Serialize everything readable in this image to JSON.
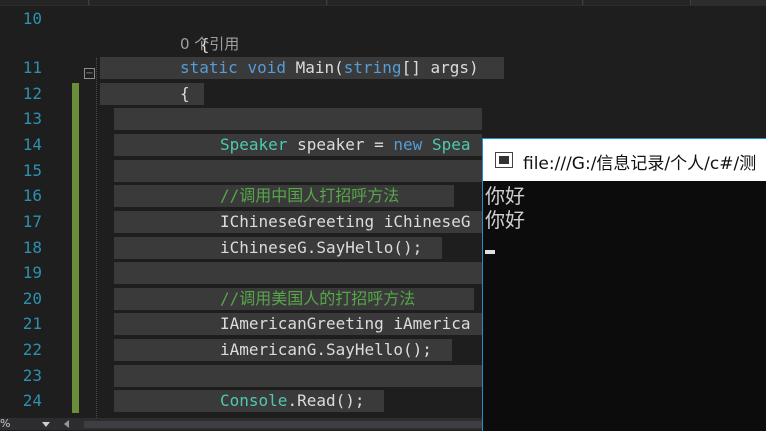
{
  "editor": {
    "ref_count": "0 个引用",
    "lines": [
      {
        "num": "10",
        "code": [
          {
            "t": "{",
            "c": ""
          }
        ]
      },
      {
        "num": "11",
        "code": [
          {
            "t": "static",
            "c": "kw"
          },
          {
            "t": " ",
            "c": ""
          },
          {
            "t": "void",
            "c": "kw"
          },
          {
            "t": " Main(",
            "c": ""
          },
          {
            "t": "string",
            "c": "kw"
          },
          {
            "t": "[] args)",
            "c": ""
          }
        ]
      },
      {
        "num": "12",
        "code": [
          {
            "t": "{",
            "c": ""
          }
        ]
      },
      {
        "num": "13",
        "code": []
      },
      {
        "num": "14",
        "code": [
          {
            "t": "Speaker",
            "c": "ty"
          },
          {
            "t": " speaker = ",
            "c": ""
          },
          {
            "t": "new",
            "c": "kw"
          },
          {
            "t": " ",
            "c": ""
          },
          {
            "t": "Spea",
            "c": "ty"
          }
        ]
      },
      {
        "num": "15",
        "code": []
      },
      {
        "num": "16",
        "code": [
          {
            "t": "//调用中国人打招呼方法",
            "c": "cm"
          }
        ]
      },
      {
        "num": "17",
        "code": [
          {
            "t": "IChineseGreeting",
            "c": ""
          },
          {
            "t": " iChineseG",
            "c": ""
          }
        ]
      },
      {
        "num": "18",
        "code": [
          {
            "t": "iChineseG.SayHello();",
            "c": ""
          }
        ]
      },
      {
        "num": "19",
        "code": []
      },
      {
        "num": "20",
        "code": [
          {
            "t": "//调用美国人的打招呼方法",
            "c": "cm"
          }
        ]
      },
      {
        "num": "21",
        "code": [
          {
            "t": "IAmericanGreeting",
            "c": ""
          },
          {
            "t": " iAmerica",
            "c": ""
          }
        ]
      },
      {
        "num": "22",
        "code": [
          {
            "t": "iAmericanG.SayHello();",
            "c": ""
          }
        ]
      },
      {
        "num": "23",
        "code": []
      },
      {
        "num": "24",
        "code": [
          {
            "t": "Console",
            "c": "ty"
          },
          {
            "t": ".Read();",
            "c": ""
          }
        ]
      }
    ]
  },
  "statusbar": {
    "zoom": "%"
  },
  "console": {
    "title": "file:///G:/信息记录/个人/c#/测",
    "output": [
      "你好",
      "你好"
    ]
  }
}
